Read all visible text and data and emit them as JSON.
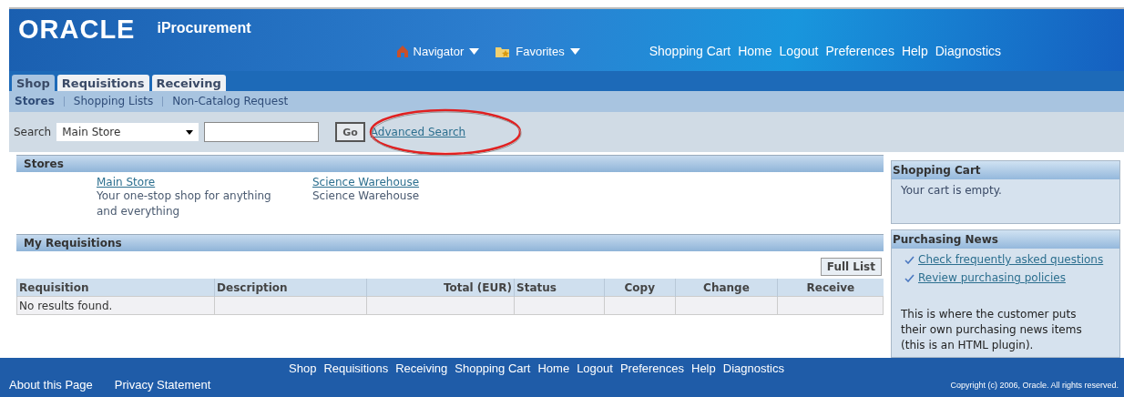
{
  "header": {
    "logo": "ORACLE",
    "app_title": "iProcurement",
    "menus": [
      {
        "label": "Navigator",
        "kind": "home"
      },
      {
        "label": "Favorites",
        "kind": "folder"
      }
    ],
    "global_links": [
      "Shopping Cart",
      "Home",
      "Logout",
      "Preferences",
      "Help",
      "Diagnostics"
    ]
  },
  "tabs": [
    {
      "label": "Shop",
      "selected": true
    },
    {
      "label": "Requisitions",
      "selected": false
    },
    {
      "label": "Receiving",
      "selected": false
    }
  ],
  "subtabs": [
    {
      "label": "Stores",
      "selected": true
    },
    {
      "label": "Shopping Lists",
      "selected": false
    },
    {
      "label": "Non-Catalog Request",
      "selected": false
    }
  ],
  "search": {
    "label": "Search",
    "store": "Main Store",
    "go": "Go",
    "advanced": "Advanced Search"
  },
  "stores": {
    "title": "Stores",
    "items": [
      {
        "name": "Main Store",
        "description": "Your one-stop shop for anything and everything"
      },
      {
        "name": "Science Warehouse",
        "description": "Science Warehouse"
      }
    ]
  },
  "requisitions": {
    "title": "My Requisitions",
    "button": "Full List",
    "columns": [
      {
        "label": "Requisition",
        "kind": "text"
      },
      {
        "label": "Description",
        "kind": "text"
      },
      {
        "label": "Total (EUR)",
        "kind": "amount"
      },
      {
        "label": "Status",
        "kind": "text"
      },
      {
        "label": "Copy",
        "kind": "action"
      },
      {
        "label": "Change",
        "kind": "action"
      },
      {
        "label": "Receive",
        "kind": "action"
      }
    ],
    "empty": "No results found."
  },
  "shopping_cart": {
    "title": "Shopping Cart",
    "text": "Your cart is empty."
  },
  "purchasing_news": {
    "title": "Purchasing News",
    "links": [
      "Check frequently asked questions",
      "Review purchasing policies"
    ],
    "text": "This is where the customer puts their own purchasing news items (this is an HTML plugin)."
  },
  "footer": {
    "links": [
      "Shop",
      "Requisitions",
      "Receiving",
      "Shopping Cart",
      "Home",
      "Logout",
      "Preferences",
      "Help",
      "Diagnostics"
    ],
    "bottom_links": [
      "About this Page",
      "Privacy Statement"
    ],
    "copyright": "Copyright (c) 2006, Oracle. All rights reserved."
  }
}
